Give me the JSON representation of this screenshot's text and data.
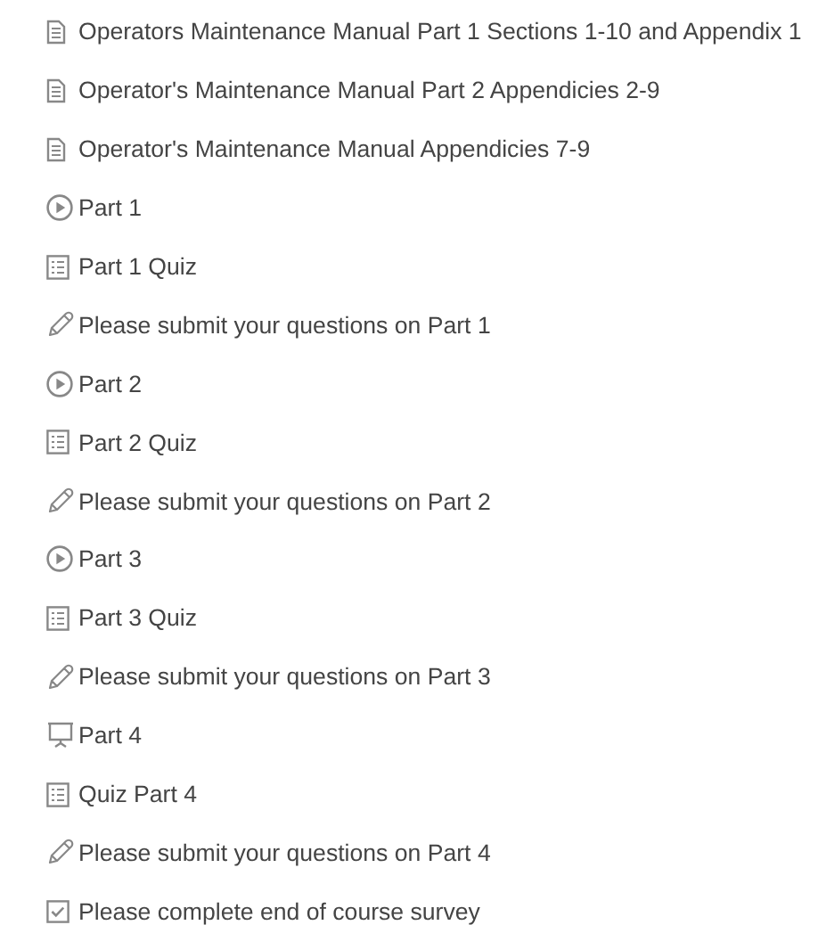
{
  "items": [
    {
      "kind": "document",
      "label": "Operators Maintenance Manual Part 1 Sections 1-10 and Appendix 1"
    },
    {
      "kind": "document",
      "label": "Operator's Maintenance Manual Part 2 Appendicies 2-9"
    },
    {
      "kind": "document",
      "label": "Operator's Maintenance Manual Appendicies 7-9"
    },
    {
      "kind": "video",
      "label": "Part 1"
    },
    {
      "kind": "quiz",
      "label": "Part 1 Quiz"
    },
    {
      "kind": "assignment",
      "label": "Please submit your questions on Part 1"
    },
    {
      "kind": "video",
      "label": "Part 2"
    },
    {
      "kind": "quiz",
      "label": "Part 2 Quiz"
    },
    {
      "kind": "assignment",
      "label": "Please submit your questions on Part 2"
    },
    {
      "kind": "video",
      "label": "Part 3"
    },
    {
      "kind": "quiz",
      "label": "Part 3 Quiz"
    },
    {
      "kind": "assignment",
      "label": "Please submit your questions on Part 3"
    },
    {
      "kind": "presentation",
      "label": "Part 4"
    },
    {
      "kind": "quiz",
      "label": "Quiz Part 4"
    },
    {
      "kind": "assignment",
      "label": "Please submit your questions on Part 4"
    },
    {
      "kind": "survey",
      "label": "Please complete end of course survey"
    }
  ]
}
